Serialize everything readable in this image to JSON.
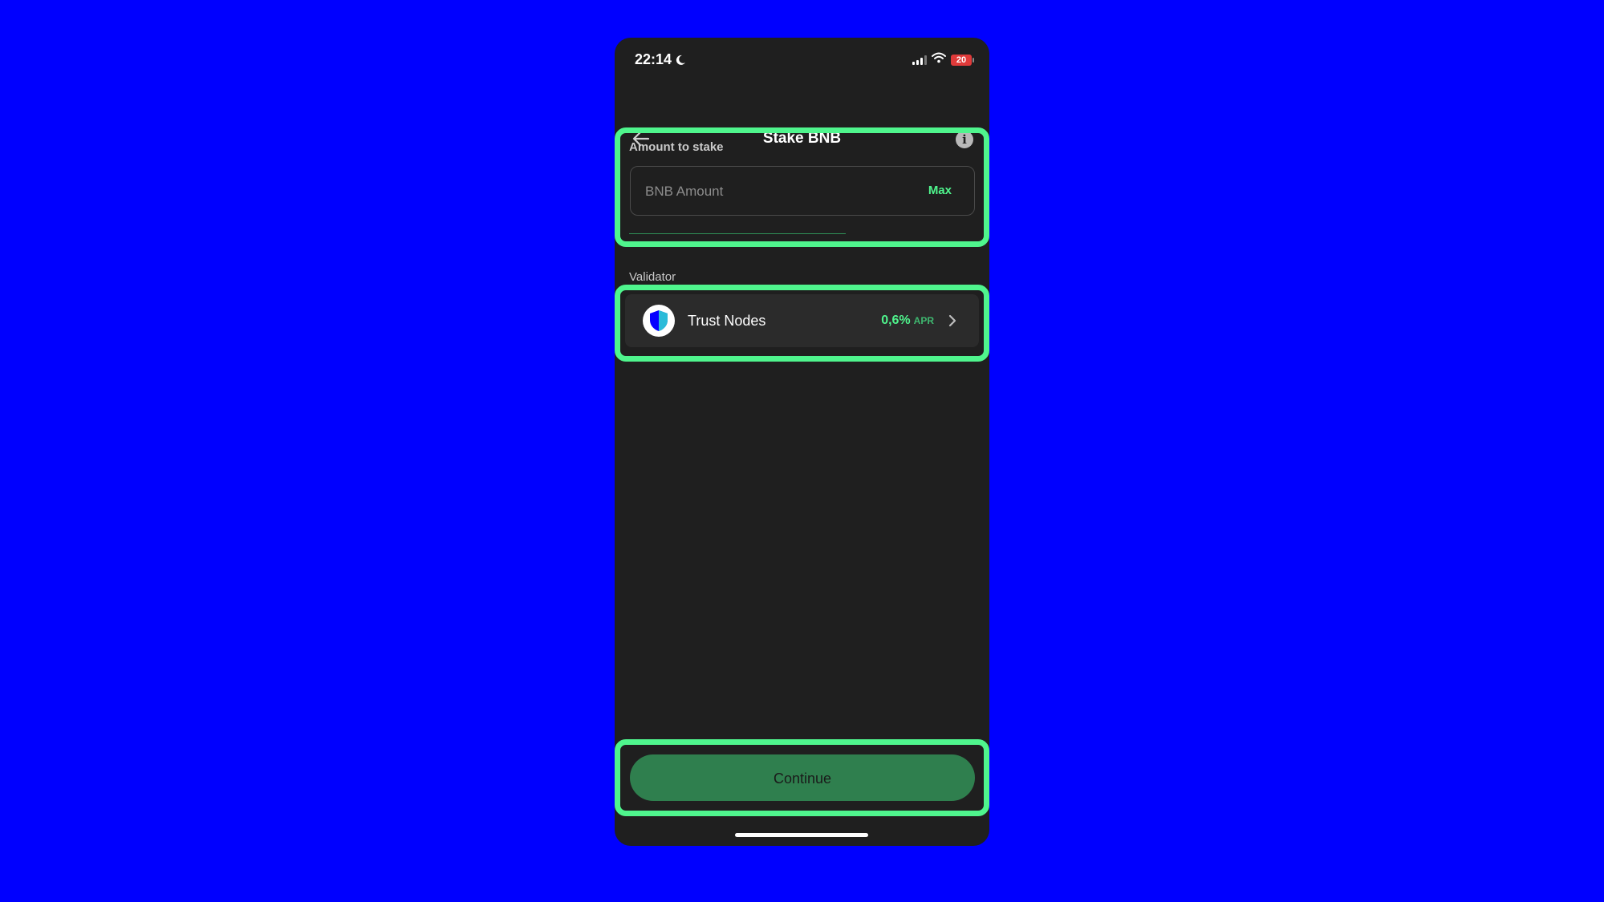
{
  "status_bar": {
    "time": "22:14",
    "battery": "20",
    "icons": [
      "moon-icon",
      "cellular-signal-icon",
      "wifi-icon",
      "battery-icon"
    ]
  },
  "header": {
    "title": "Stake BNB",
    "back_icon": "arrow-left-icon",
    "info_icon": "info-icon"
  },
  "amount": {
    "label": "Amount to stake",
    "placeholder": "BNB Amount",
    "value": "",
    "max_label": "Max"
  },
  "validator": {
    "label": "Validator",
    "name": "Trust Nodes",
    "apr_value": "0,6%",
    "apr_unit": "APR",
    "logo_icon": "trust-shield-icon",
    "chevron_icon": "chevron-right-icon"
  },
  "footer": {
    "continue_label": "Continue"
  },
  "colors": {
    "background": "#0000FF",
    "phone_bg": "#1f1f1f",
    "accent_green": "#4ff58d",
    "button_green": "#2f7f4e",
    "highlight": "#4ff58d"
  }
}
